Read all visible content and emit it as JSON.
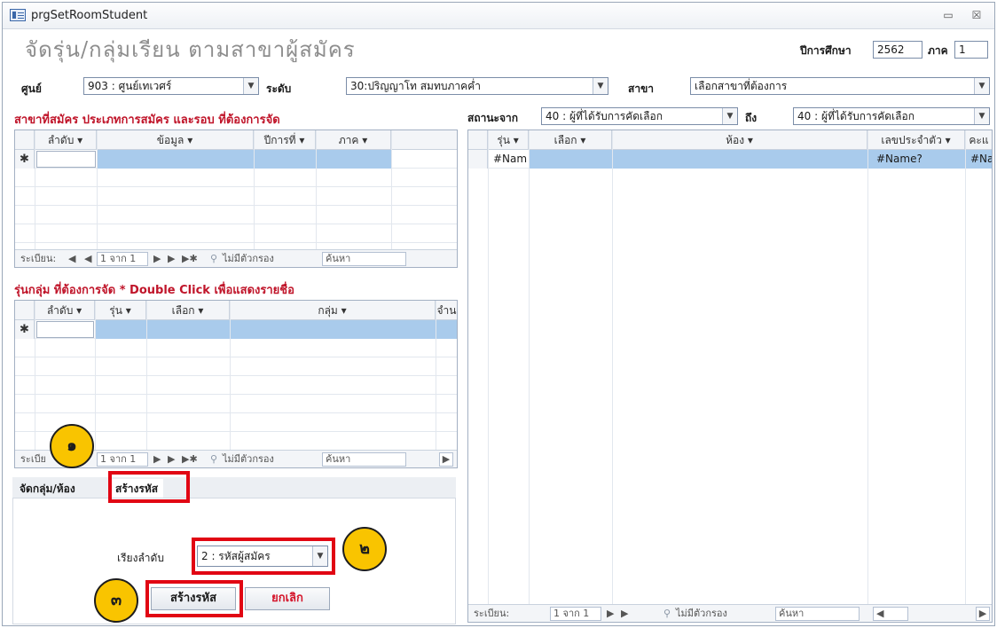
{
  "window": {
    "title": "prgSetRoomStudent",
    "min_glyph": "▭",
    "close_glyph": "☒"
  },
  "header": {
    "form_title": "จัดรุ่น/กลุ่มเรียน ตามสาขาผู้สมัคร",
    "year_label": "ปีการศึกษา",
    "year_value": "2562",
    "term_label": "ภาค",
    "term_value": "1"
  },
  "filters": {
    "center_label": "ศูนย์",
    "center_value": "903 : ศูนย์เทเวศร์",
    "level_label": "ระดับ",
    "level_value": "30:ปริญญาโท สมทบภาคค่ำ",
    "major_label": "สาขา",
    "major_value": "เลือกสาขาที่ต้องการ"
  },
  "section1": {
    "heading": "สาขาที่สมัคร ประเภทการสมัคร และรอบ ที่ต้องการจัด",
    "columns": [
      "ลำดับ",
      "ข้อมูล",
      "ปีการที่",
      "ภาค"
    ],
    "new_row_marker": "✱",
    "nav": {
      "record_label": "ระเบียน:",
      "record_pos": "1 จาก 1",
      "filter_label": "ไม่มีตัวกรอง",
      "search_label": "ค้นหา"
    }
  },
  "section2": {
    "heading": "รุ่นกลุ่ม ที่ต้องการจัด * Double Click เพื่อแสดงรายชื่อ",
    "columns": [
      "ลำดับ",
      "รุ่น",
      "เลือก",
      "กลุ่ม",
      "จำน"
    ],
    "new_row_marker": "✱",
    "nav": {
      "record_label": "ระเบีย",
      "record_pos": "1 จาก 1",
      "filter_label": "ไม่มีตัวกรอง",
      "search_label": "ค้นหา"
    }
  },
  "status_filter": {
    "from_label": "สถานะจาก",
    "from_value": "40 : ผู้ที่ได้รับการคัดเลือก",
    "to_label": "ถึง",
    "to_value": "40 : ผู้ที่ได้รับการคัดเลือก"
  },
  "right_grid": {
    "columns": [
      "รุ่น",
      "เลือก",
      "ห้อง",
      "เลขประจำตัว",
      "คะแ"
    ],
    "row": {
      "batch": "#Nam",
      "student_id": "#Name?",
      "score": "#Na"
    },
    "nav": {
      "record_label": "ระเบียน:",
      "record_pos": "1 จาก 1",
      "filter_label": "ไม่มีตัวกรอง",
      "search_label": "ค้นหา"
    }
  },
  "tabs": [
    {
      "label": "จัดกลุ่ม/ห้อง"
    },
    {
      "label": "สร้างรหัส"
    }
  ],
  "code_panel": {
    "sort_label": "เรียงลำดับ",
    "sort_value": "2 : รหัสผู้สมัคร",
    "create_button": "สร้างรหัส",
    "cancel_button": "ยกเลิก"
  },
  "annotations": [
    "๑",
    "๒",
    "๓"
  ],
  "colors": {
    "accent_red": "#e10613",
    "header_red": "#c0152a",
    "selection_blue": "#a9cbec",
    "badge_yellow": "#f9c400"
  }
}
